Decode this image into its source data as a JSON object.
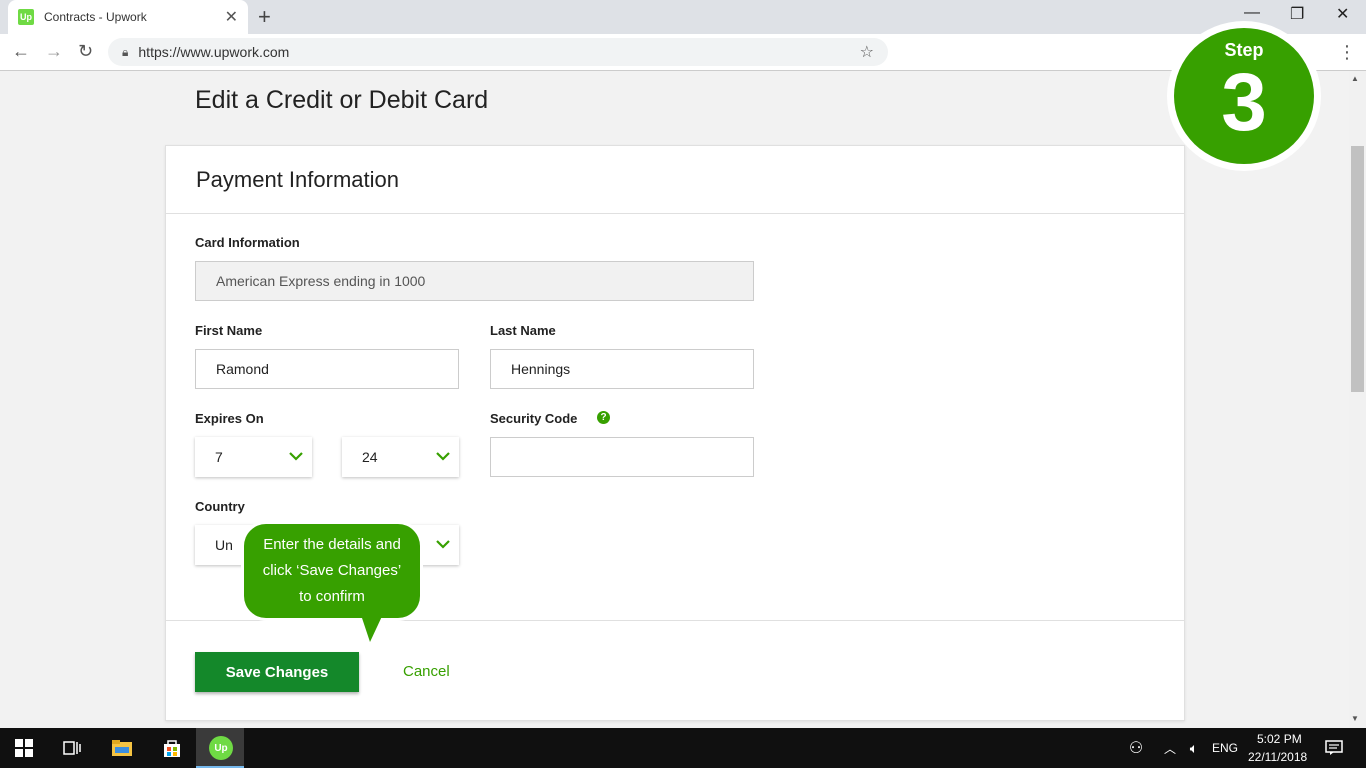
{
  "browser": {
    "tab_title": "Contracts - Upwork",
    "favicon_text": "Up",
    "url": "https://www.upwork.com",
    "icons": [
      "close-icon",
      "plus-icon",
      "back-arrow-icon",
      "forward-arrow-icon",
      "reload-icon",
      "lock-icon",
      "star-icon",
      "kebab-menu-icon",
      "minimize-icon",
      "restore-icon"
    ]
  },
  "page": {
    "title": "Edit a Credit or Debit Card"
  },
  "form": {
    "section_title": "Payment Information",
    "card_info_label": "Card Information",
    "card_info_value": "American Express ending in 1000",
    "first_name_label": "First Name",
    "first_name_value": "Ramond",
    "last_name_label": "Last Name",
    "last_name_value": "Hennings",
    "expires_label": "Expires On",
    "expires_month": "7",
    "expires_year": "24",
    "security_code_label": "Security Code",
    "security_code_value": "",
    "help_glyph": "?",
    "country_label": "Country",
    "country_value": "Un",
    "save_label": "Save Changes",
    "cancel_label": "Cancel"
  },
  "callout": {
    "line1": "Enter the details and",
    "line2": "click ‘Save Changes’",
    "line3": "to confirm"
  },
  "step": {
    "word": "Step",
    "number": "3"
  },
  "taskbar": {
    "language": "ENG",
    "time": "5:02 PM",
    "date": "22/11/2018",
    "app_text": "Up"
  },
  "colors": {
    "accent": "#37a000",
    "save_button": "#14882a",
    "brand_light": "#6fda44"
  }
}
